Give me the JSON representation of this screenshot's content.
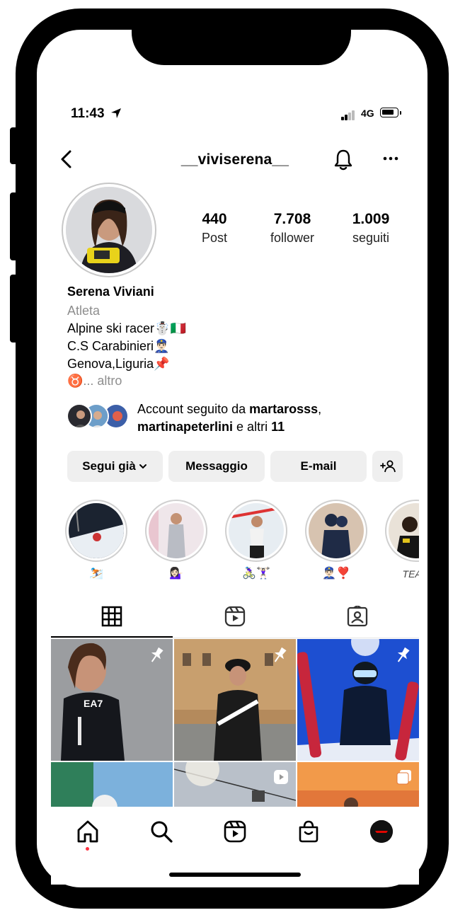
{
  "status_bar": {
    "time": "11:43",
    "network": "4G"
  },
  "header": {
    "username": "__viviserena__"
  },
  "profile": {
    "stats": [
      {
        "value": "440",
        "label": "Post"
      },
      {
        "value": "7.708",
        "label": "follower"
      },
      {
        "value": "1.009",
        "label": "seguiti"
      }
    ],
    "name": "Serena Viviani",
    "category": "Atleta",
    "bio": [
      "Alpine ski racer☃️🇮🇹",
      "C.S Carabinieri👮🏻‍♂️",
      "Genova,Liguria📌",
      "♉"
    ],
    "more_label": "... altro",
    "followed_by": {
      "prefix": "Account seguito da ",
      "user1": "martarosss",
      "sep": ",",
      "user2": "martinapeterlini",
      "middle": " e altri ",
      "count": "11"
    }
  },
  "actions": {
    "following_label": "Segui già",
    "message_label": "Messaggio",
    "email_label": "E-mail",
    "add_user_icon": "add-user-icon"
  },
  "highlights": [
    {
      "label": "⛷️"
    },
    {
      "label": "💁🏻‍♀️"
    },
    {
      "label": "🚴🏻‍♀️🏋🏻‍♀️"
    },
    {
      "label": "👮🏻‍♂️❣️"
    },
    {
      "label": "TEAM"
    }
  ],
  "tabs": [
    "grid-icon",
    "reels-icon",
    "tagged-icon"
  ],
  "bottom_nav": [
    "home-icon",
    "search-icon",
    "reels-icon",
    "shop-icon",
    "profile-avatar"
  ],
  "colors": {
    "accent_red": "#ff3040",
    "button_bg": "#efefef",
    "muted_text": "#8e8e8e"
  }
}
